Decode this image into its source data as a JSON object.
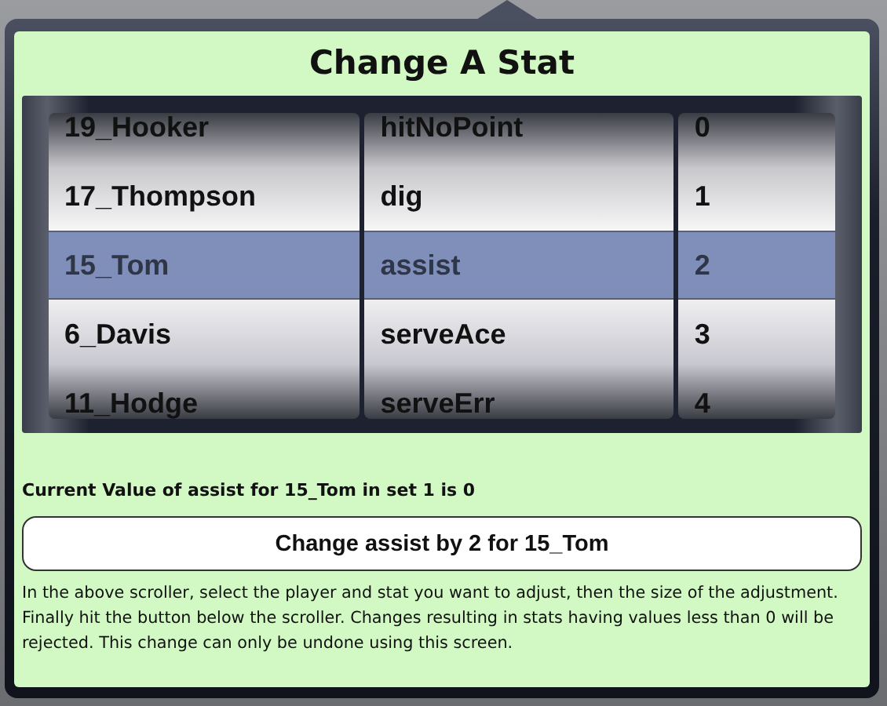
{
  "title": "Change A Stat",
  "picker": {
    "columns": [
      {
        "items": [
          {
            "text": "19_Hooker",
            "selected": false
          },
          {
            "text": "17_Thompson",
            "selected": false
          },
          {
            "text": "15_Tom",
            "selected": true
          },
          {
            "text": "6_Davis",
            "selected": false
          },
          {
            "text": "11_Hodge",
            "selected": false
          }
        ]
      },
      {
        "items": [
          {
            "text": "hitNoPoint",
            "selected": false
          },
          {
            "text": "dig",
            "selected": false
          },
          {
            "text": "assist",
            "selected": true
          },
          {
            "text": "serveAce",
            "selected": false
          },
          {
            "text": "serveErr",
            "selected": false
          }
        ]
      },
      {
        "items": [
          {
            "text": "0",
            "selected": false
          },
          {
            "text": "1",
            "selected": false
          },
          {
            "text": "2",
            "selected": true
          },
          {
            "text": "3",
            "selected": false
          },
          {
            "text": "4",
            "selected": false
          }
        ]
      }
    ]
  },
  "status": "Current Value of assist for 15_Tom in set 1 is 0",
  "button": "Change assist by 2 for 15_Tom",
  "help": "In the above scroller, select the player and stat you want to adjust, then the size of the adjustment. Finally hit the button below the scroller.  Changes resulting in stats having values less than 0 will be rejected. This change can only be undone using this screen."
}
